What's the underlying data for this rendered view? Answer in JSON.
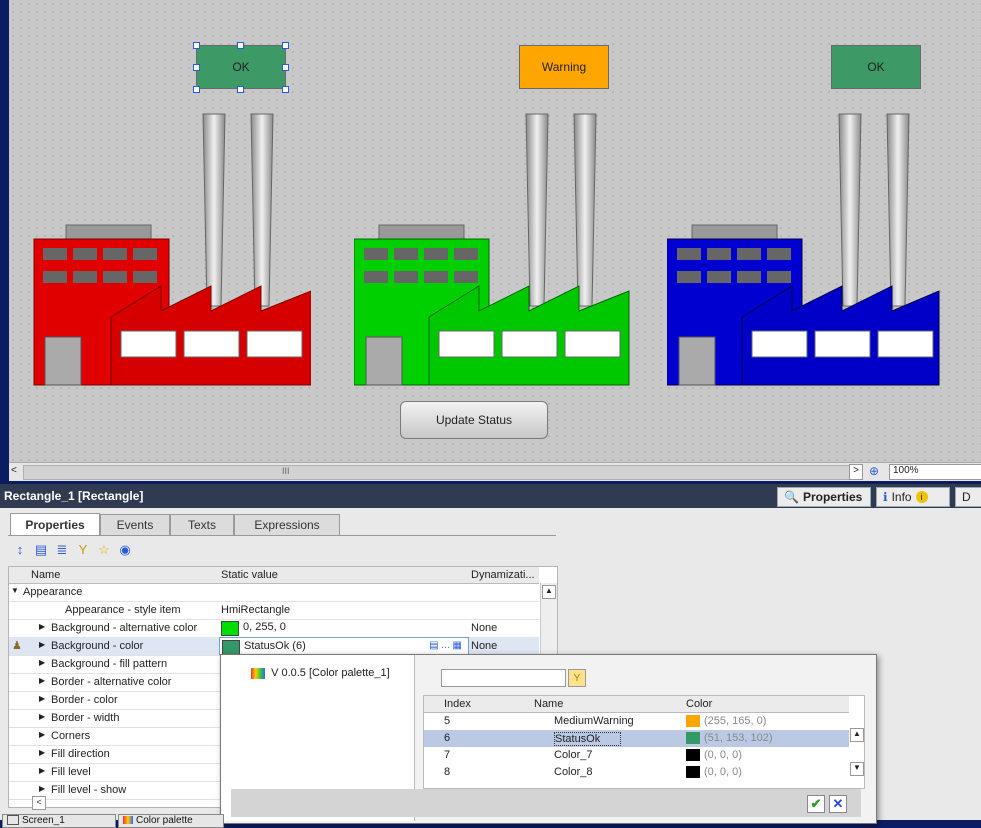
{
  "canvas": {
    "status_boxes": [
      {
        "label": "OK",
        "color": "#3d9966"
      },
      {
        "label": "Warning",
        "color": "#ffa500"
      },
      {
        "label": "OK",
        "color": "#3d9966"
      }
    ],
    "factories": [
      {
        "name": "factory-red",
        "color": "#e00000"
      },
      {
        "name": "factory-green",
        "color": "#00d000"
      },
      {
        "name": "factory-blue",
        "color": "#0000d0"
      }
    ],
    "update_button": "Update Status"
  },
  "scrollbar": {
    "zoom": "100%",
    "left_arrow": "<",
    "right_arrow": ">",
    "thumb": "III"
  },
  "titlebar": {
    "title": "Rectangle_1 [Rectangle]",
    "properties": "Properties",
    "info": "Info",
    "d": "D"
  },
  "tabs": [
    "Properties",
    "Events",
    "Texts",
    "Expressions"
  ],
  "grid": {
    "headers": {
      "name": "Name",
      "static": "Static value",
      "dyn": "Dynamizati..."
    },
    "rows": [
      {
        "name": "Appearance",
        "value": "",
        "dyn": "",
        "level": 0,
        "expanded": true
      },
      {
        "name": "Appearance - style item",
        "value": "HmiRectangle",
        "dyn": "",
        "level": 2
      },
      {
        "name": "Background - alternative color",
        "value": "0, 255, 0",
        "dyn": "None",
        "level": 1,
        "swatch": "#00e000"
      },
      {
        "name": "Background - color",
        "value": "StatusOk (6)",
        "dyn": "None",
        "level": 1,
        "swatch": "#339966",
        "selected": true
      },
      {
        "name": "Background - fill pattern",
        "value": "",
        "dyn": "",
        "level": 1
      },
      {
        "name": "Border - alternative color",
        "value": "",
        "dyn": "",
        "level": 1
      },
      {
        "name": "Border - color",
        "value": "",
        "dyn": "",
        "level": 1
      },
      {
        "name": "Border - width",
        "value": "",
        "dyn": "",
        "level": 1
      },
      {
        "name": "Corners",
        "value": "",
        "dyn": "",
        "level": 1
      },
      {
        "name": "Fill direction",
        "value": "",
        "dyn": "",
        "level": 1
      },
      {
        "name": "Fill level",
        "value": "",
        "dyn": "",
        "level": 1
      },
      {
        "name": "Fill level - show",
        "value": "",
        "dyn": "",
        "level": 1
      }
    ]
  },
  "palette": {
    "tree_item": "V 0.0.5 [Color palette_1]",
    "headers": {
      "index": "Index",
      "name": "Name",
      "color": "Color"
    },
    "rows": [
      {
        "index": "5",
        "name": "MediumWarning",
        "rgb": "(255, 165, 0)",
        "color": "#ffa500"
      },
      {
        "index": "6",
        "name": "StatusOk",
        "rgb": "(51, 153, 102)",
        "color": "#339966",
        "selected": true
      },
      {
        "index": "7",
        "name": "Color_7",
        "rgb": "(0, 0, 0)",
        "color": "#000000"
      },
      {
        "index": "8",
        "name": "Color_8",
        "rgb": "(0, 0, 0)",
        "color": "#000000"
      }
    ]
  },
  "bottom_tabs": [
    "Screen_1",
    "Color palette"
  ]
}
